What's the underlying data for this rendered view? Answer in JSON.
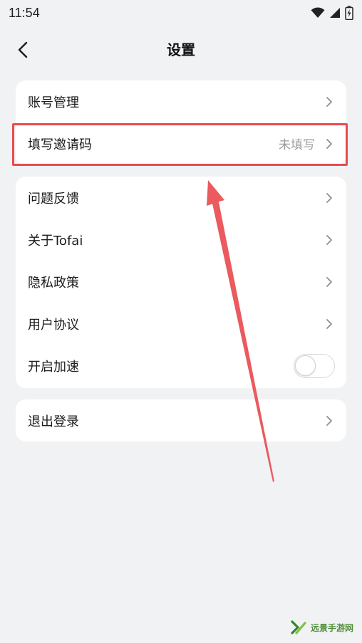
{
  "status_bar": {
    "time": "11:54"
  },
  "nav": {
    "title": "设置"
  },
  "card1": {
    "items": [
      {
        "label": "账号管理"
      },
      {
        "label": "填写邀请码",
        "value": "未填写"
      }
    ]
  },
  "card2": {
    "items": [
      {
        "label": "问题反馈"
      },
      {
        "label": "关于Tofai"
      },
      {
        "label": "隐私政策"
      },
      {
        "label": "用户协议"
      },
      {
        "label": "开启加速",
        "toggle_on": false
      }
    ]
  },
  "card3": {
    "items": [
      {
        "label": "退出登录"
      }
    ]
  },
  "annotation": {
    "highlight_color": "#ea4a4f",
    "arrow_color": "#ea4a4f"
  },
  "watermark": {
    "text": "远景手游网"
  },
  "icons": [
    "chevron-left-icon",
    "chevron-right-icon",
    "wifi-icon",
    "signal-icon",
    "battery-icon"
  ]
}
